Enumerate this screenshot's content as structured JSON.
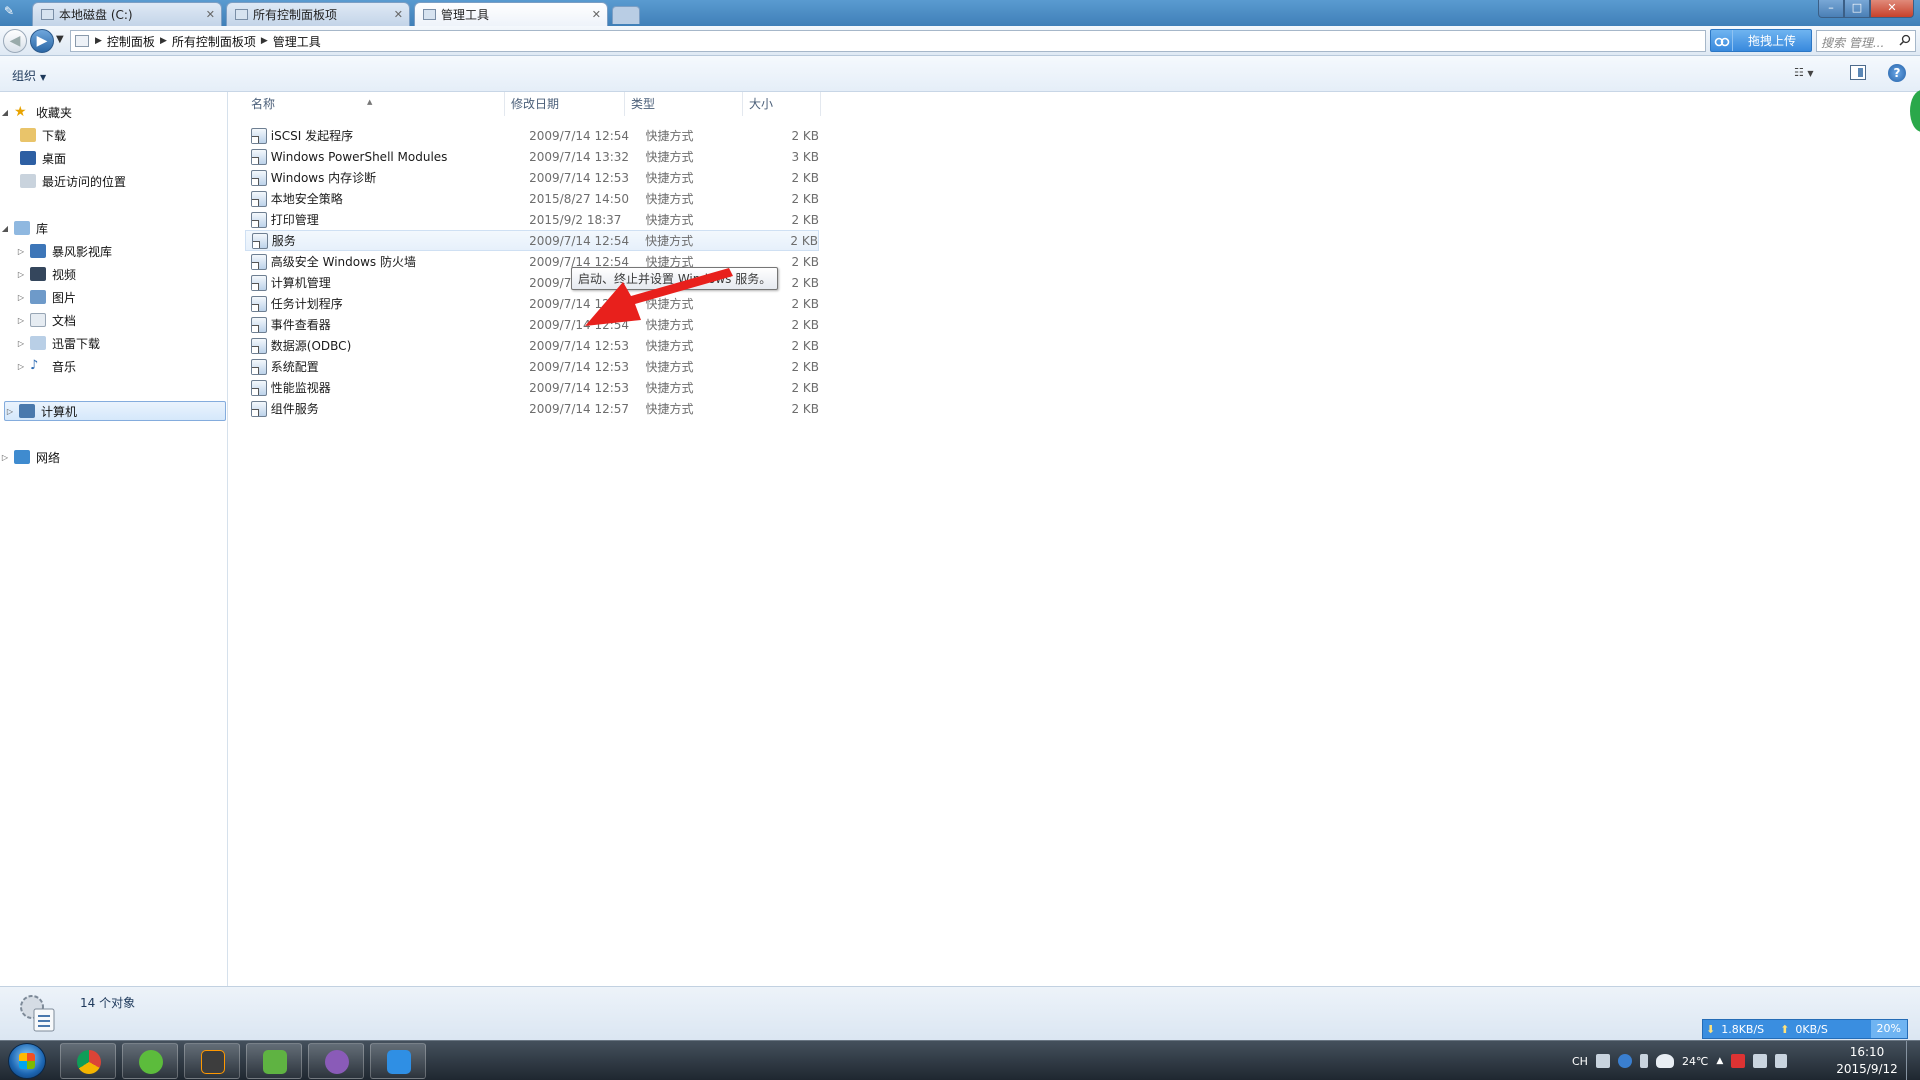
{
  "tabs": [
    {
      "label": "本地磁盘 (C:)",
      "active": false
    },
    {
      "label": "所有控制面板项",
      "active": false
    },
    {
      "label": "管理工具",
      "active": true
    }
  ],
  "window_controls": {
    "minimize": "–",
    "maximize": "□",
    "close": "✕"
  },
  "address": {
    "breadcrumbs": [
      "控制面板",
      "所有控制面板项",
      "管理工具"
    ],
    "upload_label": "拖拽上传",
    "search_placeholder": "搜索 管理..."
  },
  "toolbar": {
    "organize": "组织"
  },
  "nav": {
    "favorites": "收藏夹",
    "downloads": "下载",
    "desktop": "桌面",
    "recent": "最近访问的位置",
    "library": "库",
    "storm": "暴风影视库",
    "video": "视频",
    "pictures": "图片",
    "documents": "文档",
    "thunder": "迅雷下载",
    "music": "音乐",
    "computer": "计算机",
    "network": "网络"
  },
  "columns": {
    "name": "名称",
    "date": "修改日期",
    "type": "类型",
    "size": "大小"
  },
  "files": [
    {
      "name": "iSCSI 发起程序",
      "date": "2009/7/14 12:54",
      "type": "快捷方式",
      "size": "2 KB"
    },
    {
      "name": "Windows PowerShell Modules",
      "date": "2009/7/14 13:32",
      "type": "快捷方式",
      "size": "3 KB"
    },
    {
      "name": "Windows 内存诊断",
      "date": "2009/7/14 12:53",
      "type": "快捷方式",
      "size": "2 KB"
    },
    {
      "name": "本地安全策略",
      "date": "2015/8/27 14:50",
      "type": "快捷方式",
      "size": "2 KB"
    },
    {
      "name": "打印管理",
      "date": "2015/9/2 18:37",
      "type": "快捷方式",
      "size": "2 KB"
    },
    {
      "name": "服务",
      "date": "2009/7/14 12:54",
      "type": "快捷方式",
      "size": "2 KB"
    },
    {
      "name": "高级安全 Windows 防火墙",
      "date": "2009/7/14 12:54",
      "type": "快捷方式",
      "size": "2 KB"
    },
    {
      "name": "计算机管理",
      "date": "2009/7/14 12:54",
      "type": "快捷方式",
      "size": "2 KB"
    },
    {
      "name": "任务计划程序",
      "date": "2009/7/14 12:54",
      "type": "快捷方式",
      "size": "2 KB"
    },
    {
      "name": "事件查看器",
      "date": "2009/7/14 12:54",
      "type": "快捷方式",
      "size": "2 KB"
    },
    {
      "name": "数据源(ODBC)",
      "date": "2009/7/14 12:53",
      "type": "快捷方式",
      "size": "2 KB"
    },
    {
      "name": "系统配置",
      "date": "2009/7/14 12:53",
      "type": "快捷方式",
      "size": "2 KB"
    },
    {
      "name": "性能监视器",
      "date": "2009/7/14 12:53",
      "type": "快捷方式",
      "size": "2 KB"
    },
    {
      "name": "组件服务",
      "date": "2009/7/14 12:57",
      "type": "快捷方式",
      "size": "2 KB"
    }
  ],
  "tooltip": "启动、终止并设置 Windows 服务。",
  "status": {
    "count": "14 个对象"
  },
  "speed": {
    "down": "1.8KB/S",
    "up": "0KB/S",
    "percent": "20%"
  },
  "tray": {
    "lang": "CH",
    "temp": "24℃"
  },
  "clock": {
    "time": "16:10",
    "date": "2015/9/12"
  },
  "colors": {
    "accent": "#3a8ee0",
    "annotation_arrow": "#e8201c",
    "taskbar": "#2b343e"
  }
}
